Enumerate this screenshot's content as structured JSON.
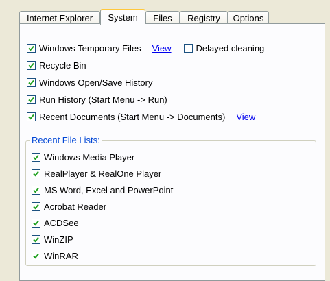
{
  "tabs": [
    {
      "label": "Internet Explorer"
    },
    {
      "label": "System"
    },
    {
      "label": "Files"
    },
    {
      "label": "Registry"
    },
    {
      "label": "Options"
    }
  ],
  "active_tab": "System",
  "system": {
    "options": [
      {
        "label": "Windows Temporary Files",
        "checked": true,
        "link": "View"
      },
      {
        "label": "Recycle Bin",
        "checked": true
      },
      {
        "label": "Windows Open/Save History",
        "checked": true
      },
      {
        "label": "Run History (Start Menu -> Run)",
        "checked": true
      },
      {
        "label": "Recent Documents (Start Menu -> Documents)",
        "checked": true,
        "link": "View"
      }
    ],
    "delayed_cleaning": {
      "label": "Delayed cleaning",
      "checked": false
    }
  },
  "recent_file_lists": {
    "title": "Recent File Lists:",
    "items": [
      {
        "label": "Windows Media Player",
        "checked": true
      },
      {
        "label": "RealPlayer & RealOne Player",
        "checked": true
      },
      {
        "label": "MS Word, Excel and PowerPoint",
        "checked": true
      },
      {
        "label": "Acrobat Reader",
        "checked": true
      },
      {
        "label": "ACDSee",
        "checked": true
      },
      {
        "label": "WinZIP",
        "checked": true
      },
      {
        "label": "WinRAR",
        "checked": true
      }
    ]
  },
  "colors": {
    "check": "#21a121",
    "legend": "#0046d5",
    "link": "#0000ee",
    "tab_highlight": "#ffc83c"
  }
}
